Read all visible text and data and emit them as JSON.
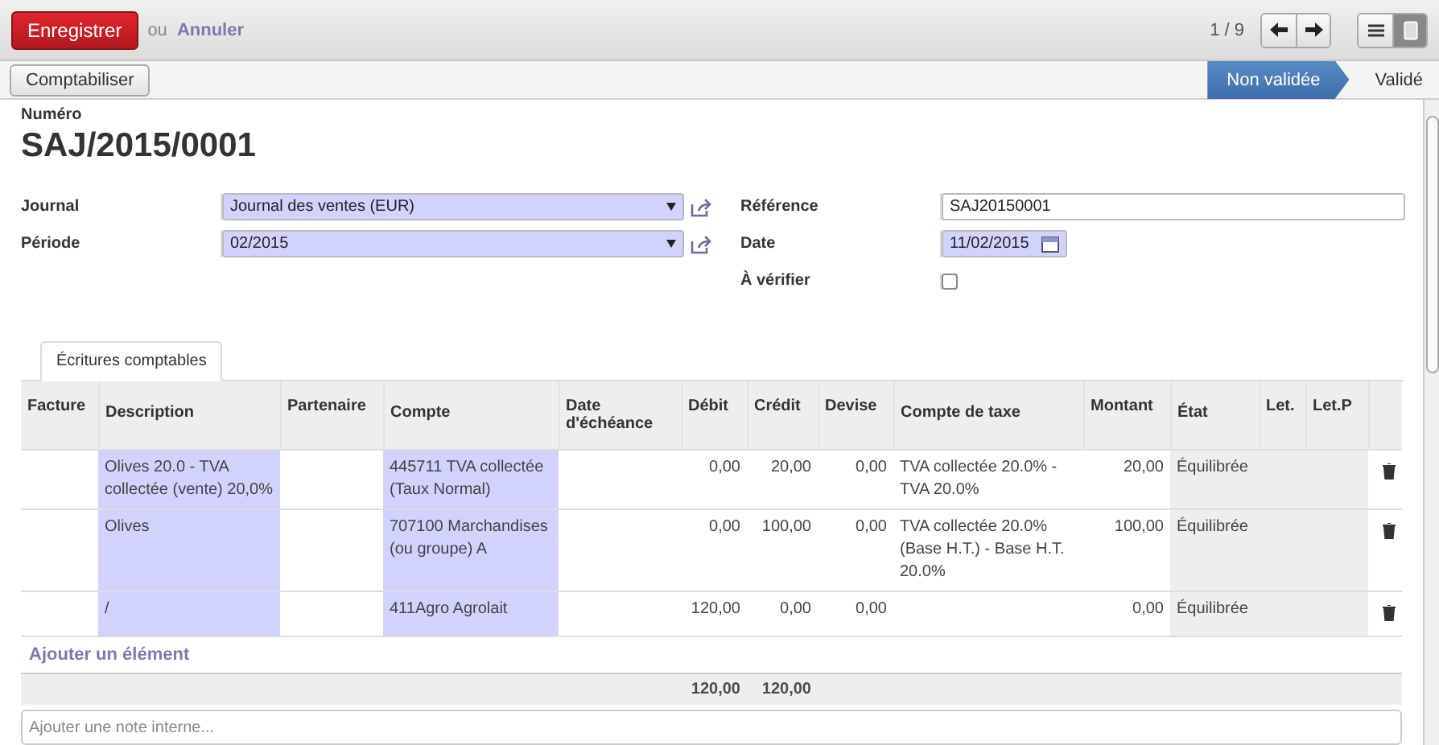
{
  "toolbar": {
    "save": "Enregistrer",
    "or": "ou",
    "cancel": "Annuler",
    "pager": "1 / 9",
    "views": [
      {
        "kind": "list",
        "selected": false
      },
      {
        "kind": "form",
        "selected": true
      }
    ]
  },
  "statusbar": {
    "action": "Comptabiliser",
    "stages": [
      {
        "label": "Non validée",
        "selected": true
      },
      {
        "label": "Validé",
        "selected": false
      }
    ]
  },
  "form": {
    "number_label": "Numéro",
    "number": "SAJ/2015/0001",
    "left": [
      {
        "label": "Journal",
        "kind": "select",
        "value": "Journal des ventes (EUR)"
      },
      {
        "label": "Période",
        "kind": "select",
        "value": "02/2015"
      }
    ],
    "right": [
      {
        "label": "Référence",
        "kind": "text",
        "value": "SAJ20150001"
      },
      {
        "label": "Date",
        "kind": "date",
        "value": "11/02/2015"
      },
      {
        "label": "À vérifier",
        "kind": "checkbox",
        "checked": false
      }
    ]
  },
  "tabs": [
    {
      "label": "Écritures comptables",
      "selected": true
    }
  ],
  "table": {
    "columns": [
      {
        "label": "Facture",
        "kind": "plain"
      },
      {
        "label": "Description",
        "kind": "required"
      },
      {
        "label": "Partenaire",
        "kind": "plain"
      },
      {
        "label": "Compte",
        "kind": "required"
      },
      {
        "label": "Date d'échéance",
        "kind": "plain"
      },
      {
        "label": "Débit",
        "kind": "number",
        "total": "120,00"
      },
      {
        "label": "Crédit",
        "kind": "number",
        "total": "120,00"
      },
      {
        "label": "Devise",
        "kind": "number"
      },
      {
        "label": "Compte de taxe",
        "kind": "plain"
      },
      {
        "label": "Montant",
        "kind": "number"
      },
      {
        "label": "État",
        "kind": "readonly"
      },
      {
        "label": "Let.",
        "kind": "readonly"
      },
      {
        "label": "Let.P",
        "kind": "readonly"
      }
    ],
    "rows": [
      {
        "cells": {
          "1": "Olives 20.0 - TVA collectée (vente) 20,0%",
          "3": "445711 TVA collectée (Taux Normal)",
          "5": "0,00",
          "6": "20,00",
          "7": "0,00",
          "8": "TVA collectée 20.0% - TVA 20.0%",
          "9": "20,00",
          "10": "Équilibrée"
        }
      },
      {
        "cells": {
          "1": "Olives",
          "3": "707100 Marchandises (ou groupe) A",
          "5": "0,00",
          "6": "100,00",
          "7": "0,00",
          "8": "TVA collectée 20.0% (Base H.T.) - Base H.T. 20.0%",
          "9": "100,00",
          "10": "Équilibrée"
        }
      },
      {
        "cells": {
          "1": "/",
          "3": "411Agro Agrolait",
          "5": "120,00",
          "6": "0,00",
          "7": "0,00",
          "9": "0,00",
          "10": "Équilibrée"
        }
      }
    ],
    "add_line": "Ajouter un élément"
  },
  "note": {
    "placeholder": "Ajouter une note interne..."
  }
}
